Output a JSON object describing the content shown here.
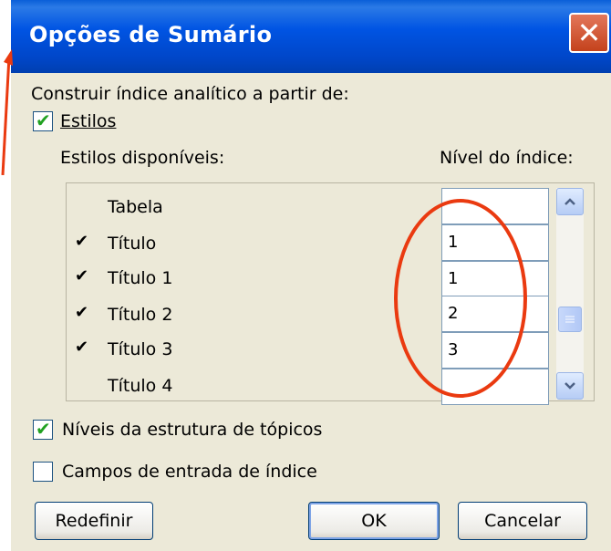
{
  "dialog": {
    "title": "Opções de Sumário",
    "close_glyph": "✕",
    "build_from_label": "Construir índice analítico a partir de:",
    "styles_checkbox": {
      "label": "Estilos",
      "checked": true
    },
    "available_styles_label": "Estilos disponíveis:",
    "index_level_label": "Nível do índice:",
    "styles_list": [
      {
        "name": "Tabela",
        "checked": false,
        "level": ""
      },
      {
        "name": "Título",
        "checked": true,
        "level": "1"
      },
      {
        "name": "Título 1",
        "checked": true,
        "level": "1"
      },
      {
        "name": "Título 2",
        "checked": true,
        "level": "2"
      },
      {
        "name": "Título 3",
        "checked": true,
        "level": "3"
      },
      {
        "name": "Título 4",
        "checked": false,
        "level": ""
      }
    ],
    "outline_levels_checkbox": {
      "label": "Níveis da estrutura de tópicos",
      "checked": true
    },
    "index_entry_fields_checkbox": {
      "label": "Campos de entrada de índice",
      "checked": false
    },
    "buttons": {
      "reset": "Redefinir",
      "ok": "OK",
      "cancel": "Cancelar"
    },
    "check_glyph": "✔",
    "list_check_glyph": "✔",
    "icons": {
      "scroll_up": "scroll-up-icon",
      "scroll_down": "scroll-down-icon",
      "close": "close-icon"
    }
  },
  "colors": {
    "titlebar": "#0054e3",
    "annotation": "#ea3a10",
    "dialog_bg": "#ece9d8"
  }
}
